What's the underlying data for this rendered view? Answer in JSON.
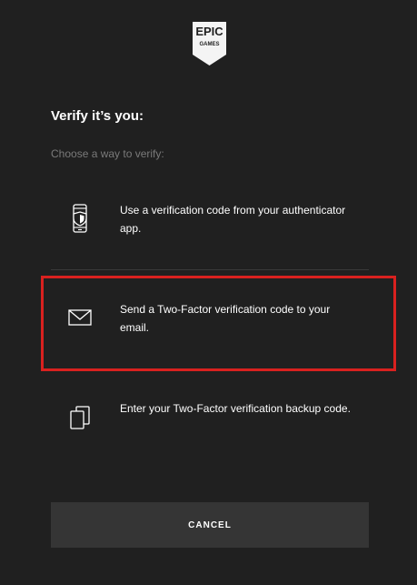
{
  "logo": {
    "line1": "EPIC",
    "line2": "GAMES"
  },
  "title": "Verify it’s you:",
  "subtitle": "Choose a way to verify:",
  "options": [
    {
      "icon": "phone-shield-icon",
      "text": "Use a verification code from your authenticator app."
    },
    {
      "icon": "envelope-icon",
      "text": "Send a Two-Factor verification code to your email."
    },
    {
      "icon": "backup-copies-icon",
      "text": "Enter your Two-Factor verification backup code."
    }
  ],
  "cancel_label": "CANCEL",
  "colors": {
    "background": "#202020",
    "highlight_border": "#d9211f",
    "button_bg": "#353535",
    "subtitle_text": "#7a7a7a"
  }
}
